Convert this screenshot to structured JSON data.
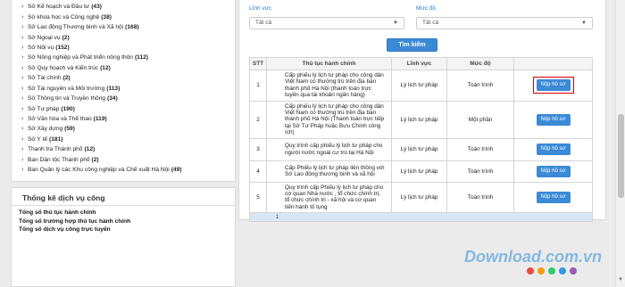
{
  "agencies": [
    {
      "name": "Sở Kế hoạch và Đầu tư",
      "count": "(43)"
    },
    {
      "name": "Sở khoa học và Công nghệ",
      "count": "(38)"
    },
    {
      "name": "Sở Lao động Thương binh và Xã hội",
      "count": "(168)"
    },
    {
      "name": "Sở Ngoại vụ",
      "count": "(2)"
    },
    {
      "name": "Sở Nội vụ",
      "count": "(152)"
    },
    {
      "name": "Sở Nông nghiệp và Phát triển nông thôn",
      "count": "(112)"
    },
    {
      "name": "Sở Quy hoạch và Kiến trúc",
      "count": "(12)"
    },
    {
      "name": "Sở Tài chính",
      "count": "(2)"
    },
    {
      "name": "Sở Tài nguyên và Môi trường",
      "count": "(113)"
    },
    {
      "name": "Sở Thông tin và Truyền thông",
      "count": "(34)"
    },
    {
      "name": "Sở Tư pháp",
      "count": "(190)"
    },
    {
      "name": "Sở Văn hóa và Thể thao",
      "count": "(119)"
    },
    {
      "name": "Sở Xây dựng",
      "count": "(59)"
    },
    {
      "name": "Sở Y tế",
      "count": "(181)"
    },
    {
      "name": "Thanh tra Thành phố",
      "count": "(12)"
    },
    {
      "name": "Ban Dân tộc Thành phố",
      "count": "(2)"
    },
    {
      "name": "Ban Quản lý các Khu công nghiệp và Chế xuất Hà Nội",
      "count": "(49)"
    }
  ],
  "stats": {
    "title": "Thống kê dịch vụ công",
    "items": [
      "Tổng số thủ tục hành chính",
      "Tổng số trường hợp thủ tục hành chính",
      "Tổng số dịch vụ công trực tuyến"
    ]
  },
  "filters": {
    "field_label": "Lĩnh vực",
    "field_value": "Tất cả",
    "level_label": "Mức độ",
    "level_value": "Tất cả",
    "search_label": "Tìm kiếm"
  },
  "table": {
    "headers": [
      "STT",
      "Thủ tục hành chính",
      "Lĩnh vực",
      "Mức độ",
      ""
    ],
    "rows": [
      {
        "stt": "1",
        "name": "Cấp phiếu lý lịch tư pháp cho công dân Việt Nam có thường trú trên địa bàn thành phố Hà Nội (thanh toán trực tuyến qua tài khoản ngân hàng)",
        "field": "Lý lịch tư pháp",
        "level": "Toàn trình",
        "action": "Nộp hồ sơ"
      },
      {
        "stt": "2",
        "name": "Cấp phiếu lý lịch tư pháp cho công dân Việt Nam có thường trú trên địa bàn thành phố Hà Nội (Thanh toán trực tiếp tại Sở Tư Pháp hoặc Bưu Chính công ích)",
        "field": "Lý lịch tư pháp",
        "level": "Một phần",
        "action": "Nộp hồ sơ"
      },
      {
        "stt": "3",
        "name": "Quy trình cấp phiếu lý lịch tư pháp cho người nước ngoài cư trú tại Hà Nội",
        "field": "Lý lịch tư pháp",
        "level": "Toàn trình",
        "action": "Nộp hồ sơ"
      },
      {
        "stt": "4",
        "name": "Cấp Phiếu lý lịch tư pháp liên thông với Sở Lao động thương binh và xã hội",
        "field": "Lý lịch tư pháp",
        "level": "Toàn trình",
        "action": "Nộp hồ sơ"
      },
      {
        "stt": "5",
        "name": "Quy trình cấp Phiếu lý lịch tư pháp cho cơ quan Nhà nước , tổ chức chính trị, tổ chức chính trị - xã hội và cơ quan tiến hành tố tụng",
        "field": "Lý lịch tư pháp",
        "level": "Toàn trình",
        "action": "Nộp hồ sơ"
      }
    ],
    "page": "1"
  },
  "watermark": "Download.com.vn",
  "colors": {
    "accent": "#3a8ad6",
    "highlight": "#d40000",
    "label": "#2d7bd2",
    "watermark_dots": [
      "#e74c3c",
      "#f39c12",
      "#2ecc71",
      "#3498db",
      "#9b59b6"
    ]
  }
}
